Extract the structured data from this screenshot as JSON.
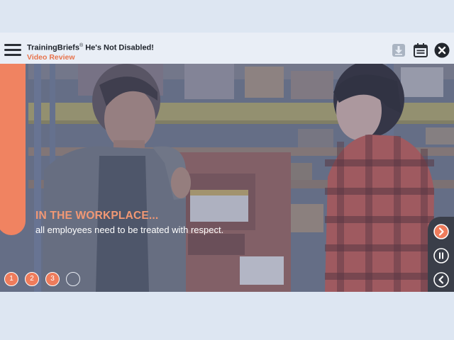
{
  "header": {
    "title_brand": "TrainingBriefs",
    "title_mark": "®",
    "title_rest": " He's Not Disabled!",
    "subtitle": "Video Review"
  },
  "toolbar": {
    "menu_icon": "hamburger-menu-icon",
    "download_icon": "download-icon",
    "calendar_icon": "calendar-icon",
    "close_icon": "close-icon"
  },
  "caption": {
    "heading": "IN THE WORKPLACE...",
    "body": "all employees need to be treated with respect."
  },
  "pager": {
    "items": [
      "1",
      "2",
      "3",
      ""
    ],
    "current_index": 3
  },
  "player_controls": {
    "next_icon": "chevron-right-icon",
    "pause_icon": "pause-icon",
    "back_icon": "chevron-left-icon"
  },
  "colors": {
    "accent": "#ef7c5c",
    "subtitle": "#e8744d",
    "toolbar_bg": "#e9eef6",
    "page_bg": "#dde6f2",
    "controls_bg": "#3a3e49"
  }
}
